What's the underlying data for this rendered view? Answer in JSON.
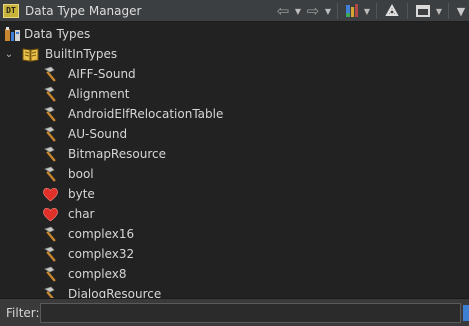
{
  "window": {
    "title": "Data Type Manager",
    "app_icon_text": "DT"
  },
  "toolbar": {
    "back_icon": "back-arrow-icon",
    "forward_icon": "forward-arrow-icon",
    "archive_icon": "archive-icon",
    "refresh_icon": "refresh-icon",
    "layout_icon": "window-layout-icon",
    "menu_icon": "view-menu-icon"
  },
  "tree": {
    "root": {
      "label": "Data Types",
      "icon": "data-types-icon"
    },
    "archive": {
      "label": "BuiltInTypes",
      "icon": "book-icon",
      "expanded": true
    },
    "items": [
      {
        "label": "AIFF-Sound",
        "icon": "hammer-icon"
      },
      {
        "label": "Alignment",
        "icon": "hammer-icon"
      },
      {
        "label": "AndroidElfRelocationTable",
        "icon": "hammer-icon"
      },
      {
        "label": "AU-Sound",
        "icon": "hammer-icon"
      },
      {
        "label": "BitmapResource",
        "icon": "hammer-icon"
      },
      {
        "label": "bool",
        "icon": "hammer-icon"
      },
      {
        "label": "byte",
        "icon": "heart-icon"
      },
      {
        "label": "char",
        "icon": "heart-icon"
      },
      {
        "label": "complex16",
        "icon": "hammer-icon"
      },
      {
        "label": "complex32",
        "icon": "hammer-icon"
      },
      {
        "label": "complex8",
        "icon": "hammer-icon"
      },
      {
        "label": "DialogResource",
        "icon": "hammer-icon"
      }
    ]
  },
  "filter": {
    "label": "Filter:",
    "value": "",
    "placeholder": ""
  },
  "colors": {
    "titlebar": "#3c3f41",
    "tree_bg": "#222222",
    "heart": "#e0302a",
    "hammer_head": "#c9c9c9",
    "hammer_handle": "#c8872f"
  }
}
